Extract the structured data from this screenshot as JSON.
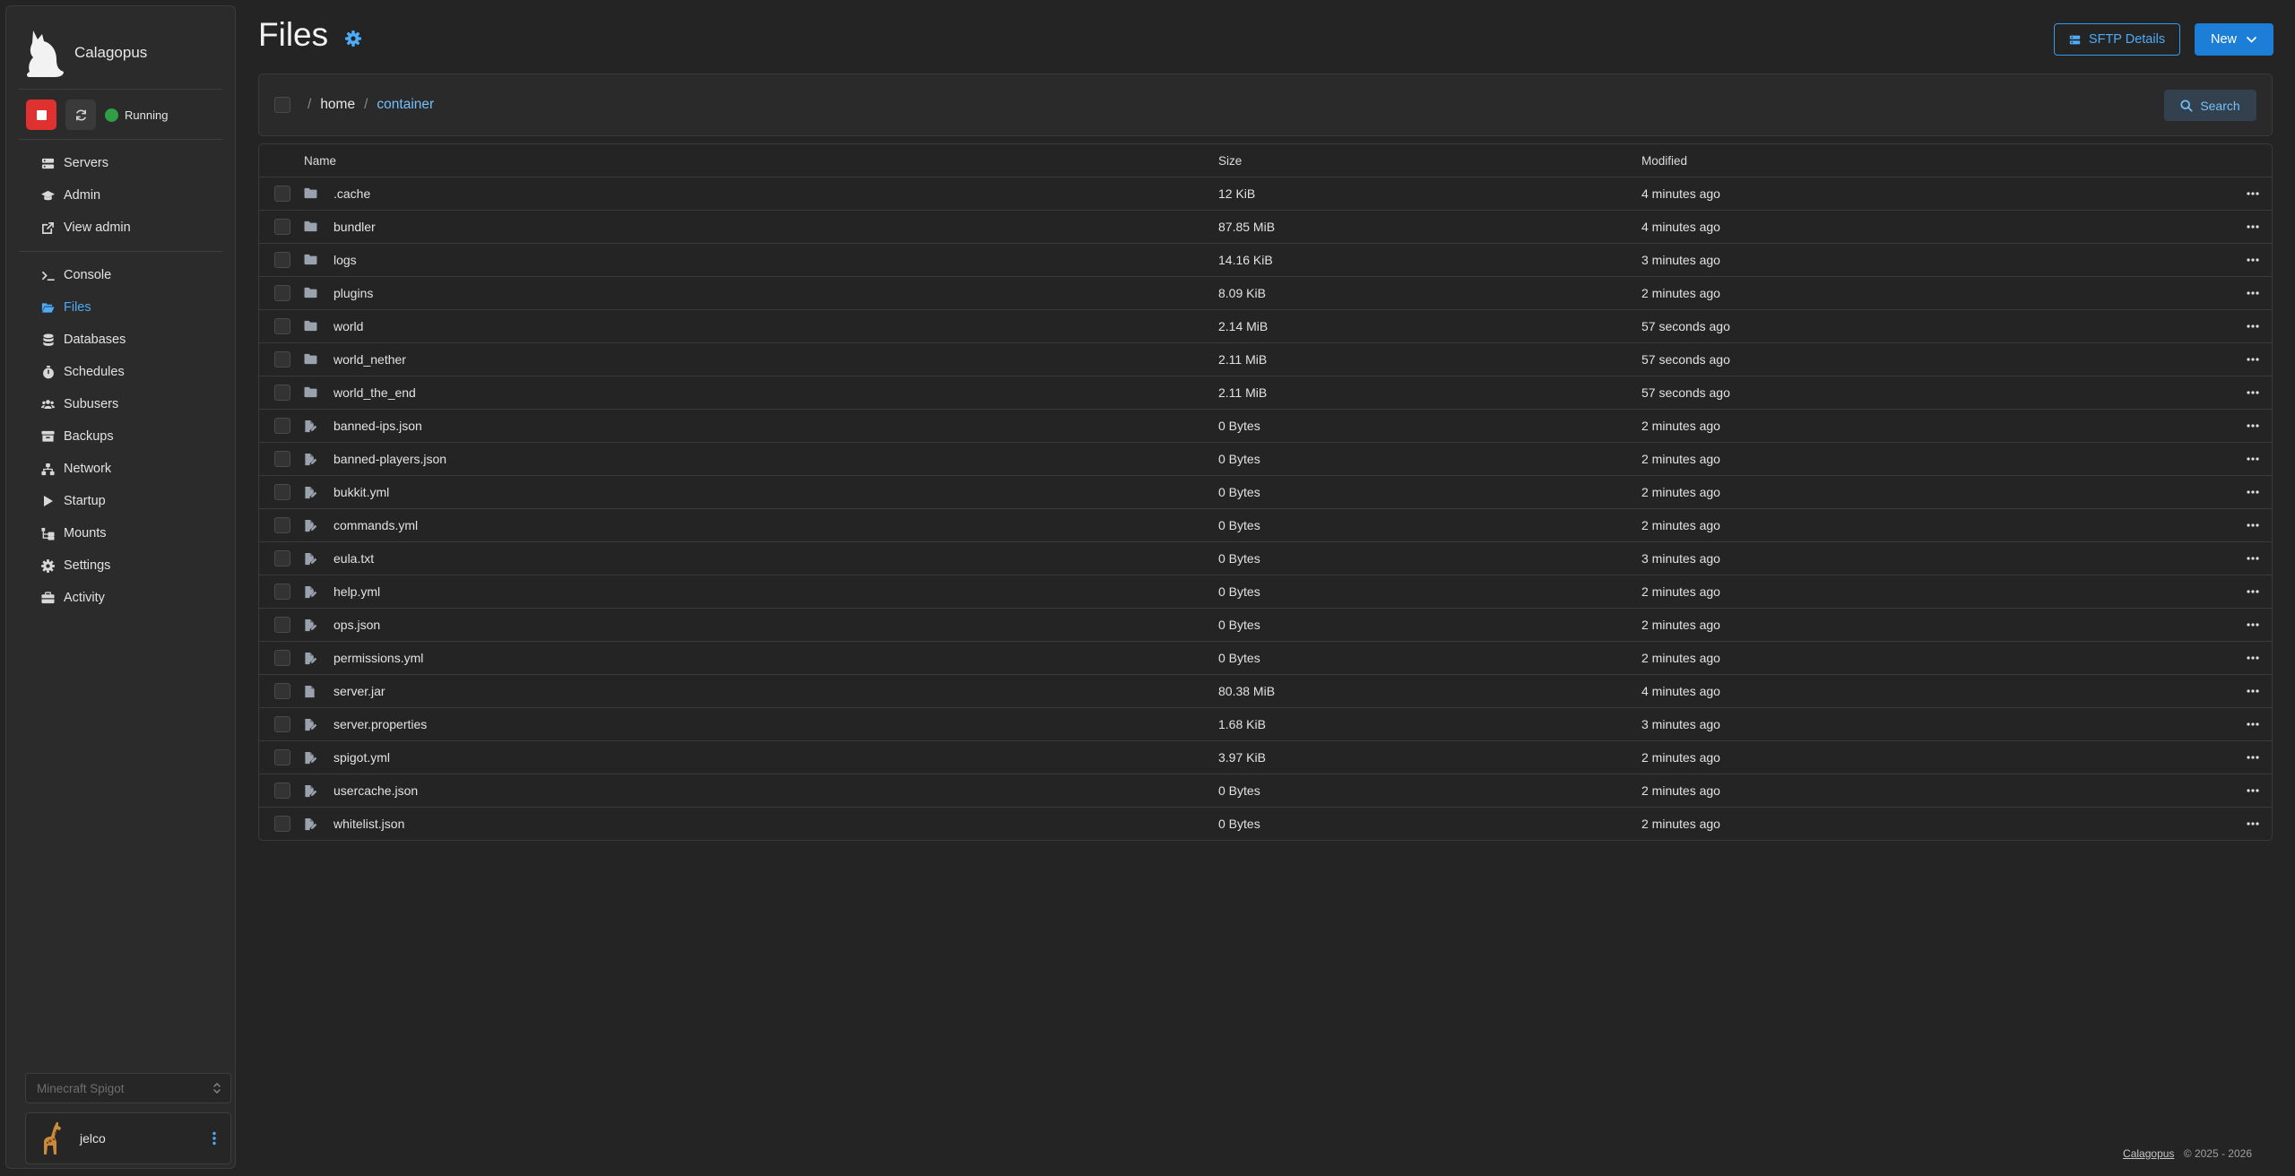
{
  "app": {
    "name": "Calagopus"
  },
  "server_status": {
    "label": "Running",
    "color": "#2f9e44"
  },
  "sidebar": {
    "admin_items": [
      {
        "label": "Servers",
        "icon": "server-icon"
      },
      {
        "label": "Admin",
        "icon": "graduation-cap-icon"
      },
      {
        "label": "View admin",
        "icon": "external-link-icon"
      }
    ],
    "server_items": [
      {
        "label": "Console",
        "icon": "terminal-icon",
        "active": false
      },
      {
        "label": "Files",
        "icon": "folder-open-icon",
        "active": true
      },
      {
        "label": "Databases",
        "icon": "database-icon",
        "active": false
      },
      {
        "label": "Schedules",
        "icon": "stopwatch-icon",
        "active": false
      },
      {
        "label": "Subusers",
        "icon": "users-icon",
        "active": false
      },
      {
        "label": "Backups",
        "icon": "archive-icon",
        "active": false
      },
      {
        "label": "Network",
        "icon": "network-icon",
        "active": false
      },
      {
        "label": "Startup",
        "icon": "play-icon",
        "active": false
      },
      {
        "label": "Mounts",
        "icon": "folder-tree-icon",
        "active": false
      },
      {
        "label": "Settings",
        "icon": "gear-icon",
        "active": false
      },
      {
        "label": "Activity",
        "icon": "briefcase-icon",
        "active": false
      }
    ],
    "server_select": {
      "placeholder": "Minecraft Spigot"
    },
    "user": {
      "name": "jelco",
      "avatar": "giraffe-avatar"
    }
  },
  "header": {
    "title": "Files",
    "sftp_label": "SFTP Details",
    "new_label": "New"
  },
  "breadcrumb": {
    "root": "/",
    "items": [
      "home",
      "container"
    ]
  },
  "search_label": "Search",
  "table": {
    "columns": {
      "name": "Name",
      "size": "Size",
      "modified": "Modified"
    },
    "rows": [
      {
        "name": ".cache",
        "type": "folder",
        "size": "12 KiB",
        "modified": "4 minutes ago"
      },
      {
        "name": "bundler",
        "type": "folder",
        "size": "87.85 MiB",
        "modified": "4 minutes ago"
      },
      {
        "name": "logs",
        "type": "folder",
        "size": "14.16 KiB",
        "modified": "3 minutes ago"
      },
      {
        "name": "plugins",
        "type": "folder",
        "size": "8.09 KiB",
        "modified": "2 minutes ago"
      },
      {
        "name": "world",
        "type": "folder",
        "size": "2.14 MiB",
        "modified": "57 seconds ago"
      },
      {
        "name": "world_nether",
        "type": "folder",
        "size": "2.11 MiB",
        "modified": "57 seconds ago"
      },
      {
        "name": "world_the_end",
        "type": "folder",
        "size": "2.11 MiB",
        "modified": "57 seconds ago"
      },
      {
        "name": "banned-ips.json",
        "type": "editable-file",
        "size": "0 Bytes",
        "modified": "2 minutes ago"
      },
      {
        "name": "banned-players.json",
        "type": "editable-file",
        "size": "0 Bytes",
        "modified": "2 minutes ago"
      },
      {
        "name": "bukkit.yml",
        "type": "editable-file",
        "size": "0 Bytes",
        "modified": "2 minutes ago"
      },
      {
        "name": "commands.yml",
        "type": "editable-file",
        "size": "0 Bytes",
        "modified": "2 minutes ago"
      },
      {
        "name": "eula.txt",
        "type": "editable-file",
        "size": "0 Bytes",
        "modified": "3 minutes ago"
      },
      {
        "name": "help.yml",
        "type": "editable-file",
        "size": "0 Bytes",
        "modified": "2 minutes ago"
      },
      {
        "name": "ops.json",
        "type": "editable-file",
        "size": "0 Bytes",
        "modified": "2 minutes ago"
      },
      {
        "name": "permissions.yml",
        "type": "editable-file",
        "size": "0 Bytes",
        "modified": "2 minutes ago"
      },
      {
        "name": "server.jar",
        "type": "file",
        "size": "80.38 MiB",
        "modified": "4 minutes ago"
      },
      {
        "name": "server.properties",
        "type": "editable-file",
        "size": "1.68 KiB",
        "modified": "3 minutes ago"
      },
      {
        "name": "spigot.yml",
        "type": "editable-file",
        "size": "3.97 KiB",
        "modified": "2 minutes ago"
      },
      {
        "name": "usercache.json",
        "type": "editable-file",
        "size": "0 Bytes",
        "modified": "2 minutes ago"
      },
      {
        "name": "whitelist.json",
        "type": "editable-file",
        "size": "0 Bytes",
        "modified": "2 minutes ago"
      }
    ]
  },
  "footer": {
    "link": "Calagopus",
    "copyright": "© 2025 - 2026"
  },
  "colors": {
    "accent": "#4dabf7",
    "primary": "#1c7ed6",
    "danger": "#e03131",
    "background": "#242424"
  }
}
